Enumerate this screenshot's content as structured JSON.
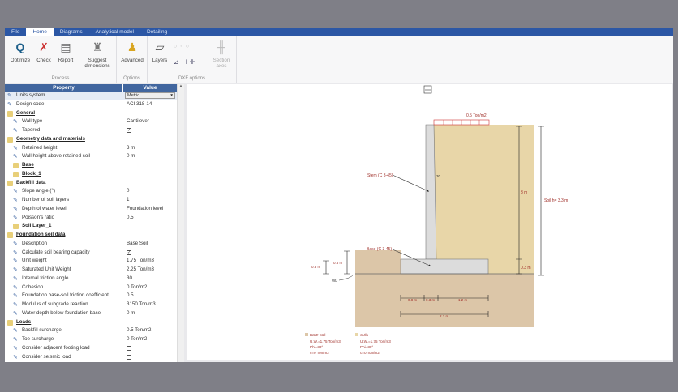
{
  "tabs": [
    "File",
    "Home",
    "Diagrams",
    "Analytical model",
    "Detailing"
  ],
  "ribbon": {
    "process": {
      "label": "Process",
      "optimize": "Optimize",
      "check": "Check",
      "report": "Report",
      "suggest": "Suggest dimensions"
    },
    "options": {
      "label": "Options",
      "advanced": "Advanced"
    },
    "dxf": {
      "label": "DXF options",
      "layers": "Layers",
      "section_axes": "Section axes"
    }
  },
  "props": {
    "header_property": "Property",
    "header_value": "Value",
    "rows": [
      {
        "name": "Units system",
        "value": "Metric",
        "type": "dropdown"
      },
      {
        "name": "Design code",
        "value": "ACI 318-14"
      },
      {
        "name": "General",
        "type": "cat"
      },
      {
        "name": "Wall type",
        "value": "Cantilever"
      },
      {
        "name": "Tapered",
        "type": "check",
        "checked": true
      },
      {
        "name": "Geometry data and materials",
        "type": "cat"
      },
      {
        "name": "Retained height",
        "value": "3 m"
      },
      {
        "name": "Wall height above retained soil",
        "value": "0 m"
      },
      {
        "name": "Base",
        "type": "sub"
      },
      {
        "name": "Block_1",
        "type": "sub"
      },
      {
        "name": "Backfill data",
        "type": "cat"
      },
      {
        "name": "Slope angle (°)",
        "value": "0"
      },
      {
        "name": "Number of soil layers",
        "value": "1"
      },
      {
        "name": "Depth of water level",
        "value": "Foundation level"
      },
      {
        "name": "Poisson's ratio",
        "value": "0.5"
      },
      {
        "name": "Soil Layer_1",
        "type": "sub"
      },
      {
        "name": "Foundation soil data",
        "type": "cat"
      },
      {
        "name": "Description",
        "value": "Base Soil"
      },
      {
        "name": "Calculate soil bearing capacity",
        "type": "check",
        "checked": true
      },
      {
        "name": "Unit weight",
        "value": "1.75 Ton/m3"
      },
      {
        "name": "Saturated Unit Weight",
        "value": "2.25 Ton/m3"
      },
      {
        "name": "Internal friction angle",
        "value": "30"
      },
      {
        "name": "Cohesion",
        "value": "0 Ton/m2"
      },
      {
        "name": "Foundation base-soil friction coefficient",
        "value": "0.5"
      },
      {
        "name": "Modulus of subgrade reaction",
        "value": "3150 Ton/m3"
      },
      {
        "name": "Water depth below foundation base",
        "value": "0 m"
      },
      {
        "name": "Loads",
        "type": "cat"
      },
      {
        "name": "Backfill surcharge",
        "value": "0.5 Ton/m2"
      },
      {
        "name": "Toe surcharge",
        "value": "0 Ton/m2"
      },
      {
        "name": "Consider adjacent footing load",
        "type": "check",
        "checked": false
      },
      {
        "name": "Consider seismic load",
        "type": "check",
        "checked": false
      }
    ]
  },
  "drawing": {
    "surcharge": "0.5 Ton/m2",
    "stem": "Stem (C 3-45)",
    "base": "Base (C 3-45)",
    "stem_slope": "30",
    "retained": "3 m",
    "soil_h": "Soil h= 3.3 m",
    "base_th": "0.3 m",
    "toe_h1": "0.3 m",
    "toe_h2": "0.5 m",
    "wl": "WL",
    "toe": "0.8 m",
    "stem_w": "0.3 m",
    "heel": "1.2 m",
    "total": "2.1 m",
    "legend": [
      {
        "title": "Base Soil",
        "l1": "U.W.=1.75 Ton/m3",
        "l2": "Phi=30°",
        "l3": "c=0 Ton/m2"
      },
      {
        "title": "Soil1",
        "l1": "U.W.=1.75 Ton/m3",
        "l2": "Phi=30°",
        "l3": "c=0 Ton/m2"
      }
    ]
  },
  "colors": {
    "accent": "#2c57a5",
    "backfill": "#e8d6a8",
    "ground": "#dcc6a8",
    "concrete": "#dcdcdc",
    "label": "#a0302a"
  }
}
